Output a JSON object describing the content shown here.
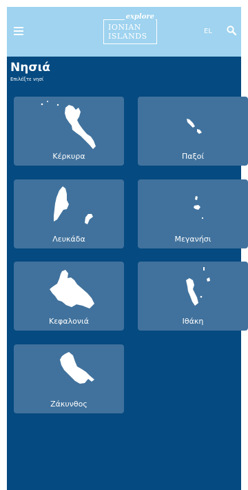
{
  "header": {
    "logo_tagline": "explore",
    "logo_line1": "IONIAN",
    "logo_line2": "ISLANDS",
    "language": "EL",
    "menu_icon": "hamburger-menu-icon",
    "search_icon": "search-icon"
  },
  "page": {
    "title": "Νησιά",
    "subtitle": "Επιλέξτε νησί"
  },
  "islands": [
    {
      "name": "Κέρκυρα",
      "icon": "corfu-map-icon"
    },
    {
      "name": "Παξοί",
      "icon": "paxoi-map-icon"
    },
    {
      "name": "Λευκάδα",
      "icon": "lefkada-map-icon"
    },
    {
      "name": "Μεγανήσι",
      "icon": "meganisi-map-icon"
    },
    {
      "name": "Κεφαλονιά",
      "icon": "kefalonia-map-icon"
    },
    {
      "name": "Ιθάκη",
      "icon": "ithaca-map-icon"
    },
    {
      "name": "Ζάκυνθος",
      "icon": "zakynthos-map-icon"
    }
  ],
  "colors": {
    "background": "#054a80",
    "appbar": "#9fd3ef",
    "card": "#41729d",
    "text": "#ffffff"
  }
}
